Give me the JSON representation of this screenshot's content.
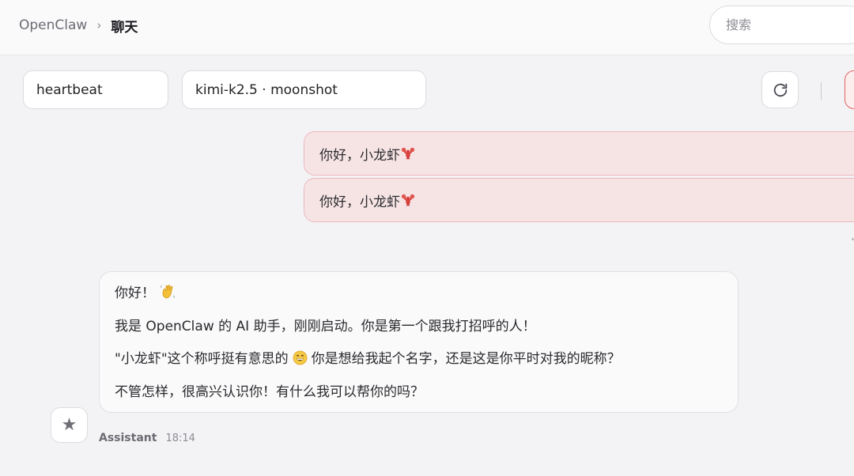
{
  "header": {
    "breadcrumb_root": "OpenClaw",
    "breadcrumb_separator": "›",
    "breadcrumb_current": "聊天",
    "search_placeholder": "搜索"
  },
  "controls": {
    "session": "heartbeat",
    "model": "kimi-k2.5 · moonshot",
    "refresh_icon": "refresh-icon",
    "divider": "|"
  },
  "messages": {
    "user": [
      {
        "text": "你好，小龙虾",
        "emoji": "lobster"
      },
      {
        "text": "你好，小龙虾",
        "emoji": "lobster"
      }
    ],
    "assistant": {
      "line1": "你好！",
      "line1_emoji": "waving-hand",
      "line2": "我是 OpenClaw 的 AI 助手，刚刚启动。你是第一个跟我打招呼的人！",
      "line3_a": "\"小龙虾\"这个称呼挺有意思的",
      "line3_emoji": "grinning-face",
      "line3_b": "你是想给我起个名字，还是这是你平时对我的昵称？",
      "line4": "不管怎样，很高兴认识你！有什么我可以帮你的吗？",
      "author": "Assistant",
      "time": "18:14",
      "avatar_icon": "star-icon",
      "avatar_glyph": "★"
    }
  },
  "colors": {
    "user_bubble_bg": "#f6e4e5",
    "user_bubble_border": "#ebb7bb",
    "accent_red": "#e06060"
  }
}
